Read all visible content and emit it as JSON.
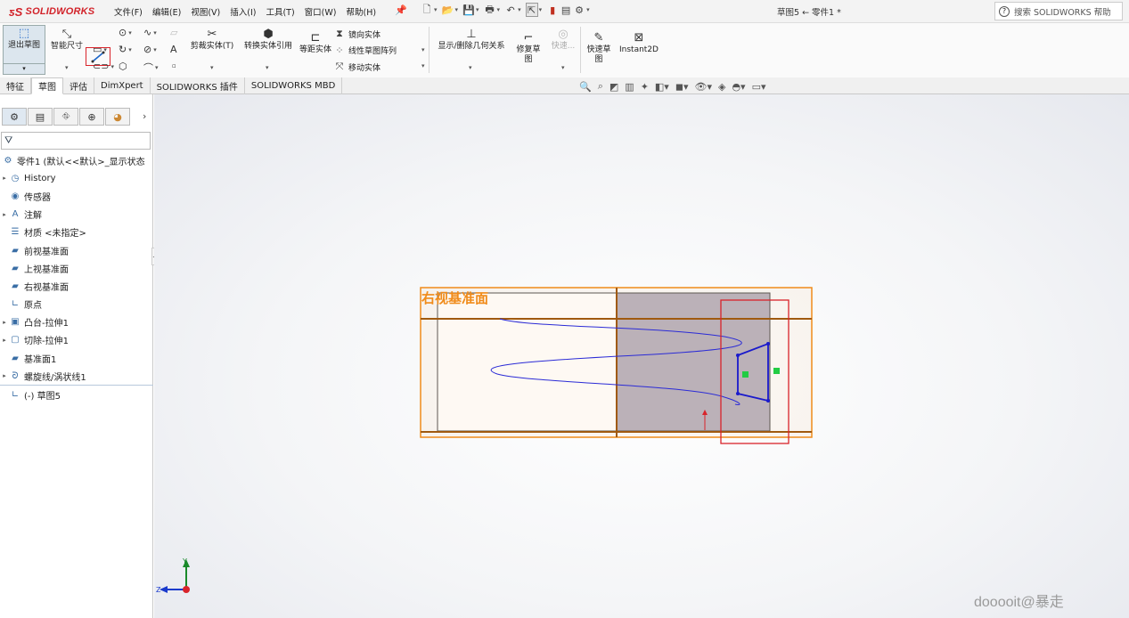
{
  "app": {
    "logo": "SOLIDWORKS",
    "doc_title": "草图5 ← 零件1 *",
    "search_placeholder": "搜索 SOLIDWORKS 帮助"
  },
  "menu": [
    "文件(F)",
    "编辑(E)",
    "视图(V)",
    "插入(I)",
    "工具(T)",
    "窗口(W)",
    "帮助(H)"
  ],
  "commands": {
    "exit_sketch": "退出草图",
    "smart_dim": "智能尺寸",
    "trim": "剪裁实体(T)",
    "convert": "转换实体引用",
    "offset": "等距实体",
    "mirror": "镜向实体",
    "linear_pattern": "线性草图阵列",
    "move": "移动实体",
    "show_relations": "显示/删除几何关系",
    "repair": "修复草图",
    "quick_snap": "快速...",
    "rapid_sketch": "快速草图",
    "instant2d": "Instant2D"
  },
  "tabs": [
    "特征",
    "草图",
    "评估",
    "DimXpert",
    "SOLIDWORKS 插件",
    "SOLIDWORKS MBD"
  ],
  "active_tab": "草图",
  "tree": [
    {
      "label": "零件1 (默认<<默认>_显示状态",
      "icon": "part-icon",
      "expand": false
    },
    {
      "label": "History",
      "icon": "history-icon",
      "expand": true
    },
    {
      "label": "传感器",
      "icon": "sensor-icon",
      "expand": false
    },
    {
      "label": "注解",
      "icon": "annotation-icon",
      "expand": true
    },
    {
      "label": "材质 <未指定>",
      "icon": "material-icon",
      "expand": false
    },
    {
      "label": "前视基准面",
      "icon": "plane-icon",
      "expand": false
    },
    {
      "label": "上视基准面",
      "icon": "plane-icon",
      "expand": false
    },
    {
      "label": "右视基准面",
      "icon": "plane-icon",
      "expand": false
    },
    {
      "label": "原点",
      "icon": "origin-icon",
      "expand": false
    },
    {
      "label": "凸台-拉伸1",
      "icon": "extrude-icon",
      "expand": true
    },
    {
      "label": "切除-拉伸1",
      "icon": "cut-icon",
      "expand": true
    },
    {
      "label": "基准面1",
      "icon": "plane-icon",
      "expand": false
    },
    {
      "label": "螺旋线/涡状线1",
      "icon": "helix-icon",
      "expand": true
    },
    {
      "label": "(-) 草图5",
      "icon": "sketch-icon",
      "expand": false
    }
  ],
  "viewport": {
    "plane_label": "右视基准面",
    "triad_y": "Y",
    "triad_z": "Z"
  },
  "watermark": "dooooit@暴走",
  "colors": {
    "plane_orange": "#f08b1a",
    "sketch_blue": "#1a1acc",
    "highlight_red": "#d9232a",
    "accent_blue": "#1a64c8"
  }
}
